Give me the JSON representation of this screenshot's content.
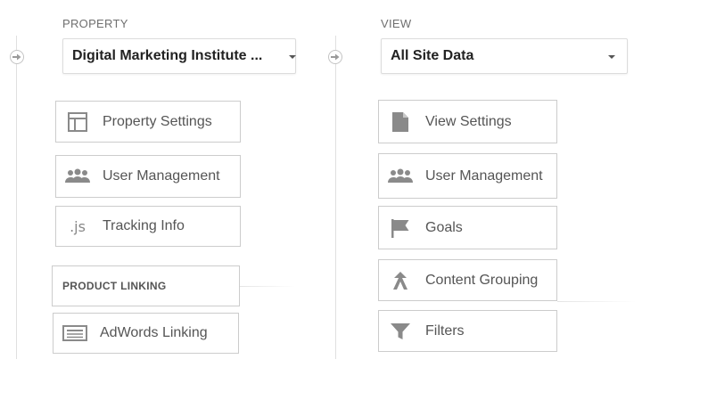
{
  "property": {
    "section_label": "PROPERTY",
    "dropdown_value": "Digital Marketing Institute ...",
    "items": [
      {
        "label": "Property Settings",
        "icon": "layout-icon"
      },
      {
        "label": "User Management",
        "icon": "users-icon"
      },
      {
        "label": "Tracking Info",
        "icon": "js-icon",
        "icon_text": ".js"
      }
    ],
    "product_linking": {
      "heading": "PRODUCT LINKING",
      "items": [
        {
          "label": "AdWords Linking",
          "icon": "adwords-icon"
        }
      ]
    }
  },
  "view": {
    "section_label": "VIEW",
    "dropdown_value": "All Site Data",
    "items": [
      {
        "label": "View Settings",
        "icon": "document-icon"
      },
      {
        "label": "User Management",
        "icon": "users-icon"
      },
      {
        "label": "Goals",
        "icon": "flag-icon"
      },
      {
        "label": "Content Grouping",
        "icon": "grouping-icon"
      },
      {
        "label": "Filters",
        "icon": "filter-icon"
      }
    ]
  },
  "colors": {
    "icon_gray": "#8a8a8a",
    "border": "#cccccc",
    "text": "#555555"
  }
}
